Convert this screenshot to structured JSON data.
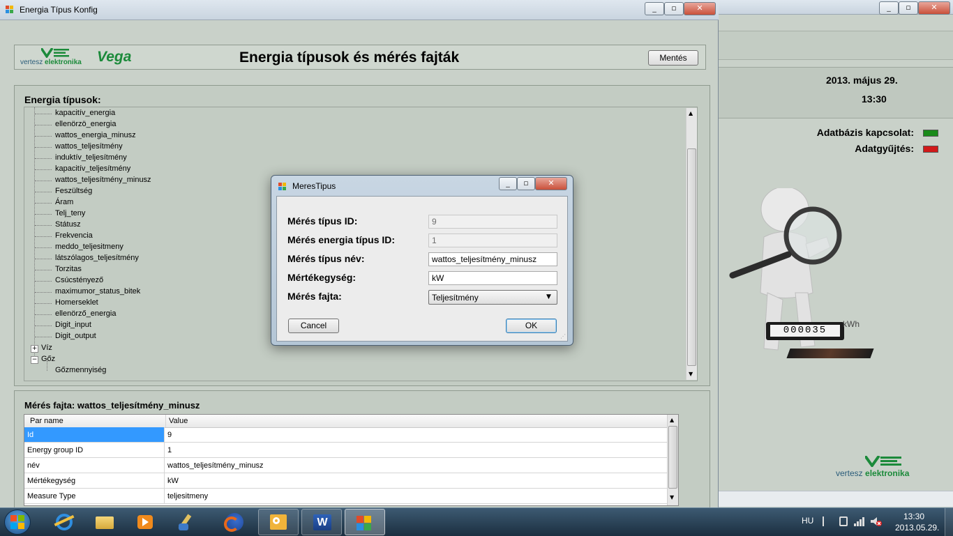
{
  "main_window": {
    "title": "Energia Típus Konfig",
    "header": {
      "logo_text_1": "vertesz",
      "logo_text_2": "elektronika",
      "brand": "Vega",
      "title": "Energia típusok és mérés fajták",
      "save_label": "Mentés"
    },
    "tree": {
      "heading": "Energia típusok:",
      "items": [
        "kapacitív_energia",
        "ellenörzö_energia",
        "wattos_energia_minusz",
        "wattos_teljesítmény",
        "induktív_teljesítmény",
        "kapacitív_teljesítmény",
        "wattos_teljesítmény_minusz",
        "Feszültség",
        "Áram",
        "Telj_teny",
        "Státusz",
        "Frekvencia",
        "meddo_teljesitmeny",
        "látszólagos_teljesítmény",
        "Torzitas",
        "Csúcstényező",
        "maximumor_status_bitek",
        "Homerseklet",
        "ellenörző_energia",
        "Digit_input",
        "Digit_output"
      ],
      "groups": [
        {
          "label": "Víz",
          "toggle": "+"
        },
        {
          "label": "Gőz",
          "toggle": "−"
        }
      ],
      "subitem": "Gőzmennyiség"
    },
    "grid": {
      "heading": "Mérés fajta: wattos_teljesítmény_minusz",
      "col_name": "Par name",
      "col_value": "Value",
      "rows": [
        {
          "name": "Id",
          "value": "9"
        },
        {
          "name": "Energy group ID",
          "value": "1"
        },
        {
          "name": "név",
          "value": "wattos_teljesítmény_minusz"
        },
        {
          "name": "Mértékegység",
          "value": "kW"
        },
        {
          "name": "Measure Type",
          "value": "teljesitmeny"
        }
      ]
    }
  },
  "background_app": {
    "date": "2013. május 29.",
    "time": "13:30",
    "db_label": "Adatbázis kapcsolat:",
    "collect_label": "Adatgyűjtés:",
    "db_status_color": "#1a8a1a",
    "collect_status_color": "#d11a1a",
    "meter_digits": "000035",
    "meter_unit": "kWh",
    "logo_text_1": "vertesz",
    "logo_text_2": "elektronika"
  },
  "dialog": {
    "title": "MeresTipus",
    "fields": {
      "id_label": "Mérés típus ID:",
      "id_value": "9",
      "energy_id_label": "Mérés energia típus ID:",
      "energy_id_value": "1",
      "name_label": "Mérés típus név:",
      "name_value": "wattos_teljesítmény_minusz",
      "unit_label": "Mértékegység:",
      "unit_value": "kW",
      "kind_label": "Mérés fajta:",
      "kind_value": "Teljesítmény"
    },
    "cancel_label": "Cancel",
    "ok_label": "OK"
  },
  "taskbar": {
    "language": "HU",
    "time": "13:30",
    "date": "2013.05.29."
  }
}
